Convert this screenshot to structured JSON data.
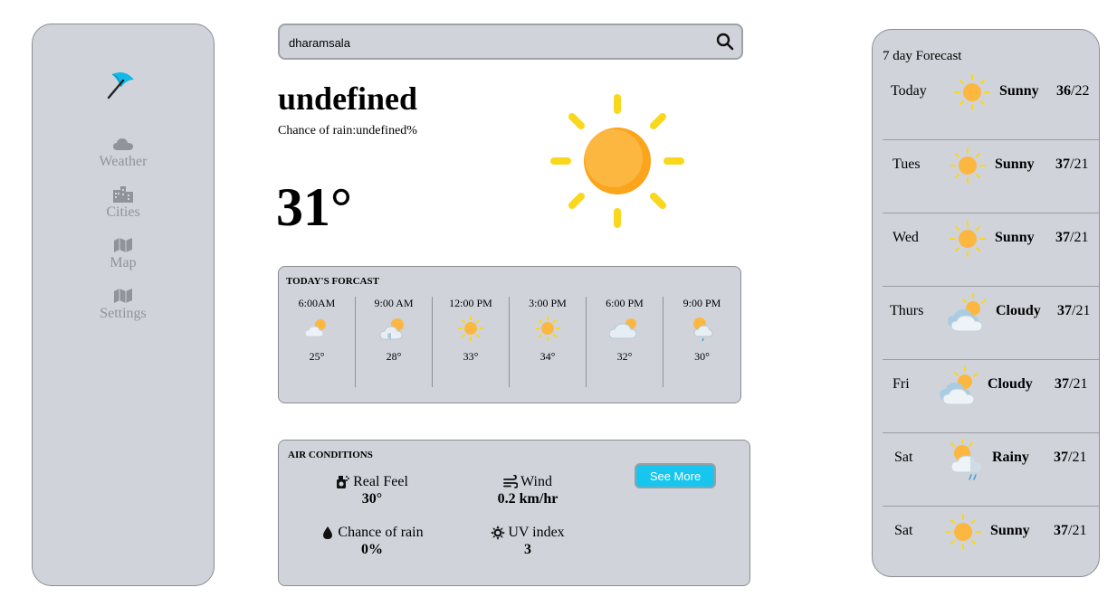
{
  "sidebar": {
    "logo": "umbrella-icon",
    "items": [
      {
        "label": "Weather",
        "icon": "cloud-icon"
      },
      {
        "label": "Cities",
        "icon": "city-icon"
      },
      {
        "label": "Map",
        "icon": "map-icon"
      },
      {
        "label": "Settings",
        "icon": "map-icon"
      }
    ]
  },
  "search": {
    "value": "dharamsala",
    "icon": "search-icon"
  },
  "current": {
    "city": "undefined",
    "rain_chance": "Chance of rain:undefined%",
    "temperature": "31°",
    "icon": "sun-icon"
  },
  "today": {
    "title": "TODAY'S FORCAST",
    "hours": [
      {
        "time": "6:00AM",
        "temp": "25°",
        "icon": "sun-cloud-icon"
      },
      {
        "time": "9:00 AM",
        "temp": "28°",
        "icon": "sun-cloud-icon"
      },
      {
        "time": "12:00 PM",
        "temp": "33°",
        "icon": "sun-icon"
      },
      {
        "time": "3:00 PM",
        "temp": "34°",
        "icon": "sun-icon"
      },
      {
        "time": "6:00 PM",
        "temp": "32°",
        "icon": "cloud-sun-icon"
      },
      {
        "time": "9:00 PM",
        "temp": "30°",
        "icon": "rain-sun-icon"
      }
    ]
  },
  "air": {
    "title": "AIR CONDITIONS",
    "real_feel": {
      "label": "Real Feel",
      "value": "30°"
    },
    "wind": {
      "label": "Wind",
      "value": "0.2 km/hr"
    },
    "rain": {
      "label": "Chance of rain",
      "value": "0%"
    },
    "uv": {
      "label": "UV index",
      "value": "3"
    },
    "see_more": "See More"
  },
  "week": {
    "title": "7 day Forecast",
    "days": [
      {
        "day": "Today",
        "cond": "Sunny",
        "hi": "36",
        "lo": "/22",
        "icon": "sun-icon"
      },
      {
        "day": "Tues",
        "cond": "Sunny",
        "hi": "37",
        "lo": "/21",
        "icon": "sun-icon"
      },
      {
        "day": "Wed",
        "cond": "Sunny",
        "hi": "37",
        "lo": "/21",
        "icon": "sun-icon"
      },
      {
        "day": "Thurs",
        "cond": "Cloudy",
        "hi": "37",
        "lo": "/21",
        "icon": "cloudy-icon"
      },
      {
        "day": "Fri",
        "cond": "Cloudy",
        "hi": "37",
        "lo": "/21",
        "icon": "cloudy-icon"
      },
      {
        "day": "Sat",
        "cond": "Rainy",
        "hi": "37",
        "lo": "/21",
        "icon": "rain-icon"
      },
      {
        "day": "Sat",
        "cond": "Sunny",
        "hi": "37",
        "lo": "/21",
        "icon": "sun-icon"
      }
    ]
  },
  "colors": {
    "panel": "#d0d4da",
    "accent": "#16c6ee",
    "sun": "#fbb034",
    "ray": "#f9d71c",
    "muted": "#8f949a"
  }
}
